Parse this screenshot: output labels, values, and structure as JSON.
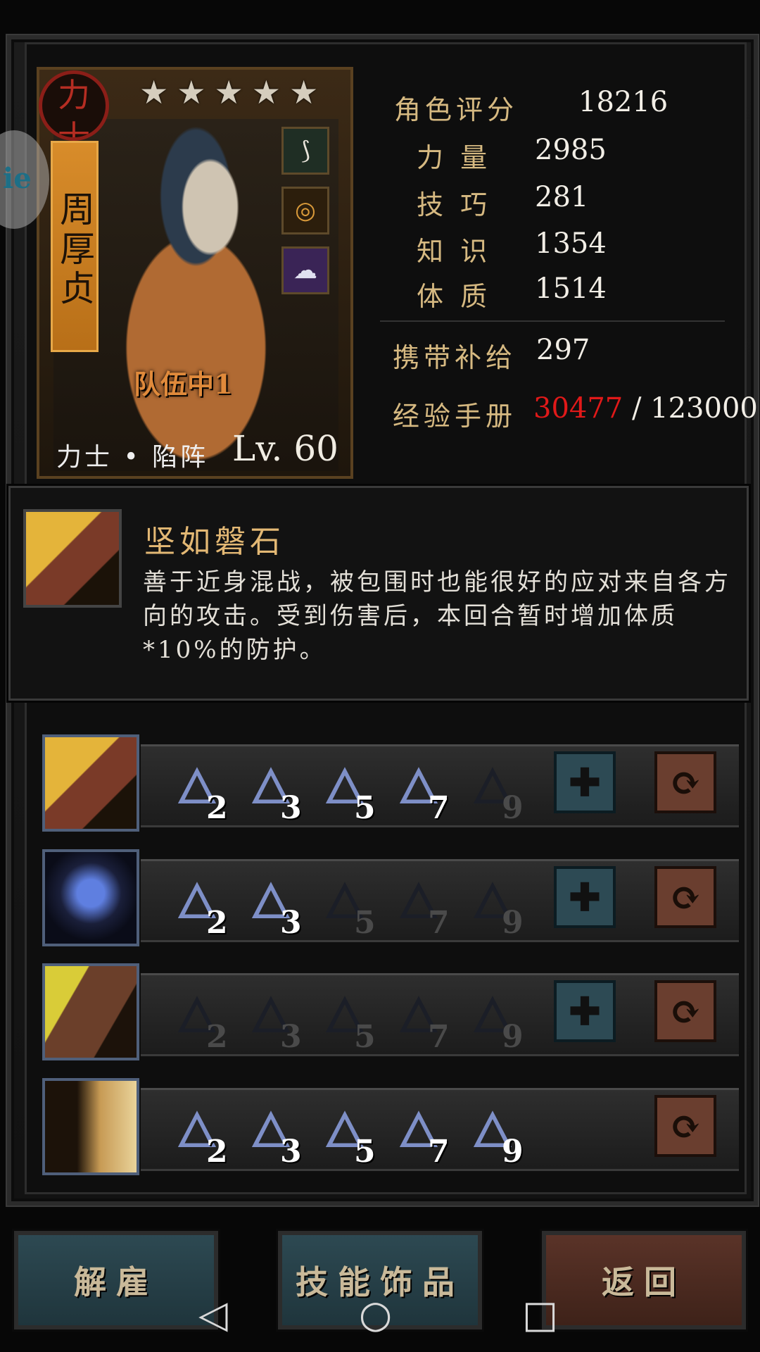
{
  "hero": {
    "class_seal": "力士",
    "name": "周厚贞",
    "stars": 5,
    "team_label": "队伍中1",
    "class_line": "力士 • 陷阵",
    "level_prefix": "Lv.",
    "level": "60",
    "equipment": [
      "amulet-icon",
      "ring-icon",
      "mask-icon"
    ]
  },
  "stats": {
    "rating_label": "角色评分",
    "rating": "18216",
    "strength_label": "力 量",
    "strength": "2985",
    "skill_label": "技 巧",
    "skill": "281",
    "knowledge_label": "知 识",
    "knowledge": "1354",
    "constitution_label": "体 质",
    "constitution": "1514",
    "supply_label": "携带补给",
    "supply": "297",
    "exp_label": "经验手册",
    "exp_current": "30477",
    "exp_sep": " / ",
    "exp_total": "123000"
  },
  "tooltip": {
    "title": "坚如磐石",
    "description": "善于近身混战，被包围时也能很好的应对来自各方向的攻击。受到伤害后，本回合暂时增加体质*10%的防护。"
  },
  "skills": [
    {
      "icon": "slash-skill-icon",
      "levels": [
        "2",
        "3",
        "5",
        "7",
        "9"
      ],
      "unlocked": 4,
      "plus": true
    },
    {
      "icon": "stance-skill-icon",
      "levels": [
        "2",
        "3",
        "5",
        "7",
        "9"
      ],
      "unlocked": 2,
      "plus": true
    },
    {
      "icon": "strike-skill-icon",
      "levels": [
        "2",
        "3",
        "5",
        "7",
        "9"
      ],
      "unlocked": 0,
      "plus": true
    },
    {
      "icon": "dash-skill-icon",
      "levels": [
        "2",
        "3",
        "5",
        "7",
        "9"
      ],
      "unlocked": 5,
      "plus": false
    }
  ],
  "buttons": {
    "dismiss": "解雇",
    "skill_trinket": "技能饰品",
    "back": "返回"
  },
  "colors": {
    "exp_current": "#e01919",
    "label_gold": "#d6b981",
    "flame_on": "#7e8fc7"
  }
}
